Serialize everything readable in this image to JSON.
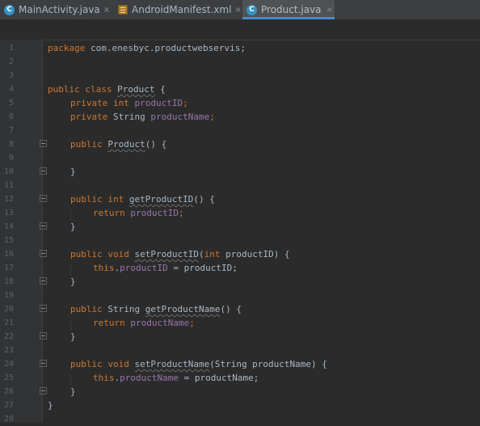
{
  "tabs": [
    {
      "label": "MainActivity.java",
      "icon": "java-class-icon",
      "active": false
    },
    {
      "label": "AndroidManifest.xml",
      "icon": "manifest-icon",
      "active": false
    },
    {
      "label": "Product.java",
      "icon": "java-class-icon",
      "active": true
    }
  ],
  "tab_icon_letter": "C",
  "close_glyph": "×",
  "line_numbers": [
    "1",
    "2",
    "3",
    "4",
    "5",
    "6",
    "7",
    "8",
    "9",
    "10",
    "11",
    "12",
    "13",
    "14",
    "15",
    "16",
    "17",
    "18",
    "19",
    "20",
    "21",
    "22",
    "23",
    "24",
    "25",
    "26",
    "27",
    "28"
  ],
  "code": {
    "l1_kw": "package",
    "l1_rest": " com.enesbyc.productwebservis;",
    "l4_kw": "public class",
    "l4_name": "Product",
    "l4_brace": " {",
    "l5_kw": "private int",
    "l5_field": "productID",
    "l5_end": ";",
    "l6_kw": "private",
    "l6_type": " String ",
    "l6_field": "productName",
    "l6_end": ";",
    "l8_kw": "public",
    "l8_name": "Product",
    "l8_rest": "() {",
    "l10_brace": "}",
    "l12_kw": "public int",
    "l12_name": "getProductID",
    "l12_rest": "() {",
    "l13_kw": "return",
    "l13_field": "productID",
    "l13_end": ";",
    "l14_brace": "}",
    "l16_kw": "public void",
    "l16_name": "setProductID",
    "l16_open": "(",
    "l16_kw2": "int",
    "l16_param": " productID) {",
    "l17_kw": "this",
    "l17_dot": ".",
    "l17_field": "productID",
    "l17_rest": " = productID;",
    "l18_brace": "}",
    "l20_kw": "public",
    "l20_type": " String ",
    "l20_name": "getProductName",
    "l20_rest": "() {",
    "l21_kw": "return",
    "l21_field": "productName",
    "l21_end": ";",
    "l22_brace": "}",
    "l24_kw": "public void",
    "l24_name": "setProductName",
    "l24_rest": "(String productName) {",
    "l25_kw": "this",
    "l25_dot": ".",
    "l25_field": "productName",
    "l25_rest": " = productName;",
    "l26_brace": "}",
    "l27_brace": "}"
  },
  "colors": {
    "background": "#2b2b2b",
    "gutter": "#313335",
    "keyword": "#cc7832",
    "field": "#9876aa",
    "plain": "#a9b7c6",
    "active_tab_underline": "#4a88c7"
  }
}
